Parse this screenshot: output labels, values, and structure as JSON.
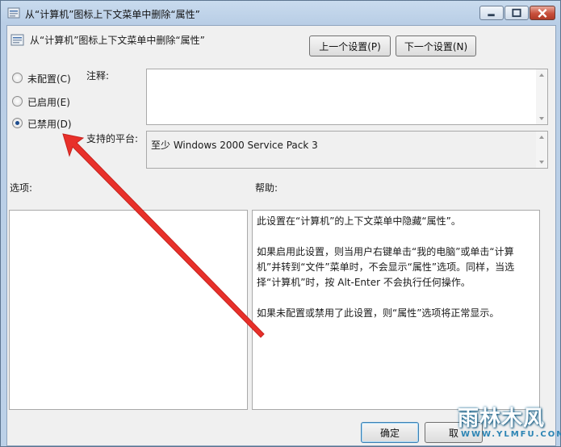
{
  "window": {
    "title": "从“计算机”图标上下文菜单中删除“属性”"
  },
  "header": {
    "policy_title": "从“计算机”图标上下文菜单中删除“属性”",
    "prev_button": "上一个设置(P)",
    "next_button": "下一个设置(N)"
  },
  "state_options": [
    {
      "label": "未配置(C)",
      "selected": false
    },
    {
      "label": "已启用(E)",
      "selected": false
    },
    {
      "label": "已禁用(D)",
      "selected": true
    }
  ],
  "comment": {
    "label": "注释:",
    "value": ""
  },
  "platform": {
    "label": "支持的平台:",
    "value": "至少 Windows 2000 Service Pack 3"
  },
  "options": {
    "label": "选项:"
  },
  "help": {
    "label": "帮助:",
    "paragraphs": [
      "此设置在“计算机”的上下文菜单中隐藏“属性”。",
      "如果启用此设置，则当用户右键单击“我的电脑”或单击“计算机”并转到“文件”菜单时，不会显示“属性”选项。同样，当选择“计算机”时，按 Alt-Enter 不会执行任何操作。",
      "如果未配置或禁用了此设置，则“属性”选项将正常显示。"
    ]
  },
  "footer": {
    "ok_button": "确定",
    "cancel_button": "取"
  },
  "watermark": {
    "text": "雨林木风",
    "url": "WWW.YLMFU.COM"
  },
  "colors": {
    "annotation_arrow": "#e8302a",
    "selected_radio": "#1c4c8e"
  }
}
